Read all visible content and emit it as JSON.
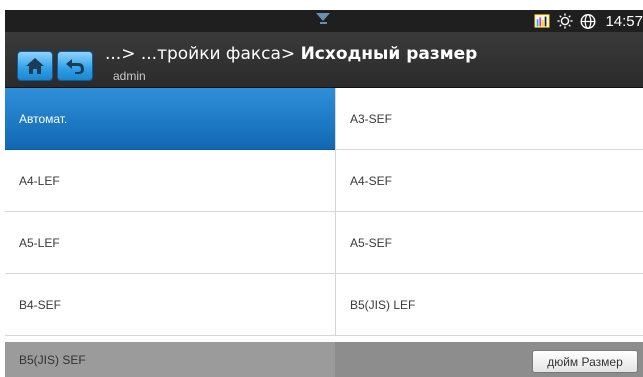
{
  "status_bar": {
    "time": "14:57",
    "icons": [
      "notification-drawer-icon",
      "toner-level-icon",
      "eco-sun-icon",
      "network-globe-icon"
    ]
  },
  "header": {
    "breadcrumb_prefix": "...> ...тройки факса>",
    "title": "Исходный размер",
    "user": "admin",
    "home_icon": "home-icon",
    "back_icon": "back-icon"
  },
  "sizes": {
    "left": [
      "Автомат.",
      "A4-LEF",
      "A5-LEF",
      "B4-SEF",
      "B5(JIS) SEF"
    ],
    "right": [
      "A3-SEF",
      "A4-SEF",
      "A5-SEF",
      "B5(JIS) LEF"
    ],
    "selected": "Автомат."
  },
  "footer": {
    "unit_button": "дюйм Размер"
  },
  "colors": {
    "accent": "#1f7fcf",
    "titlebar": "#333333",
    "statusbar": "#1f1f1f"
  }
}
